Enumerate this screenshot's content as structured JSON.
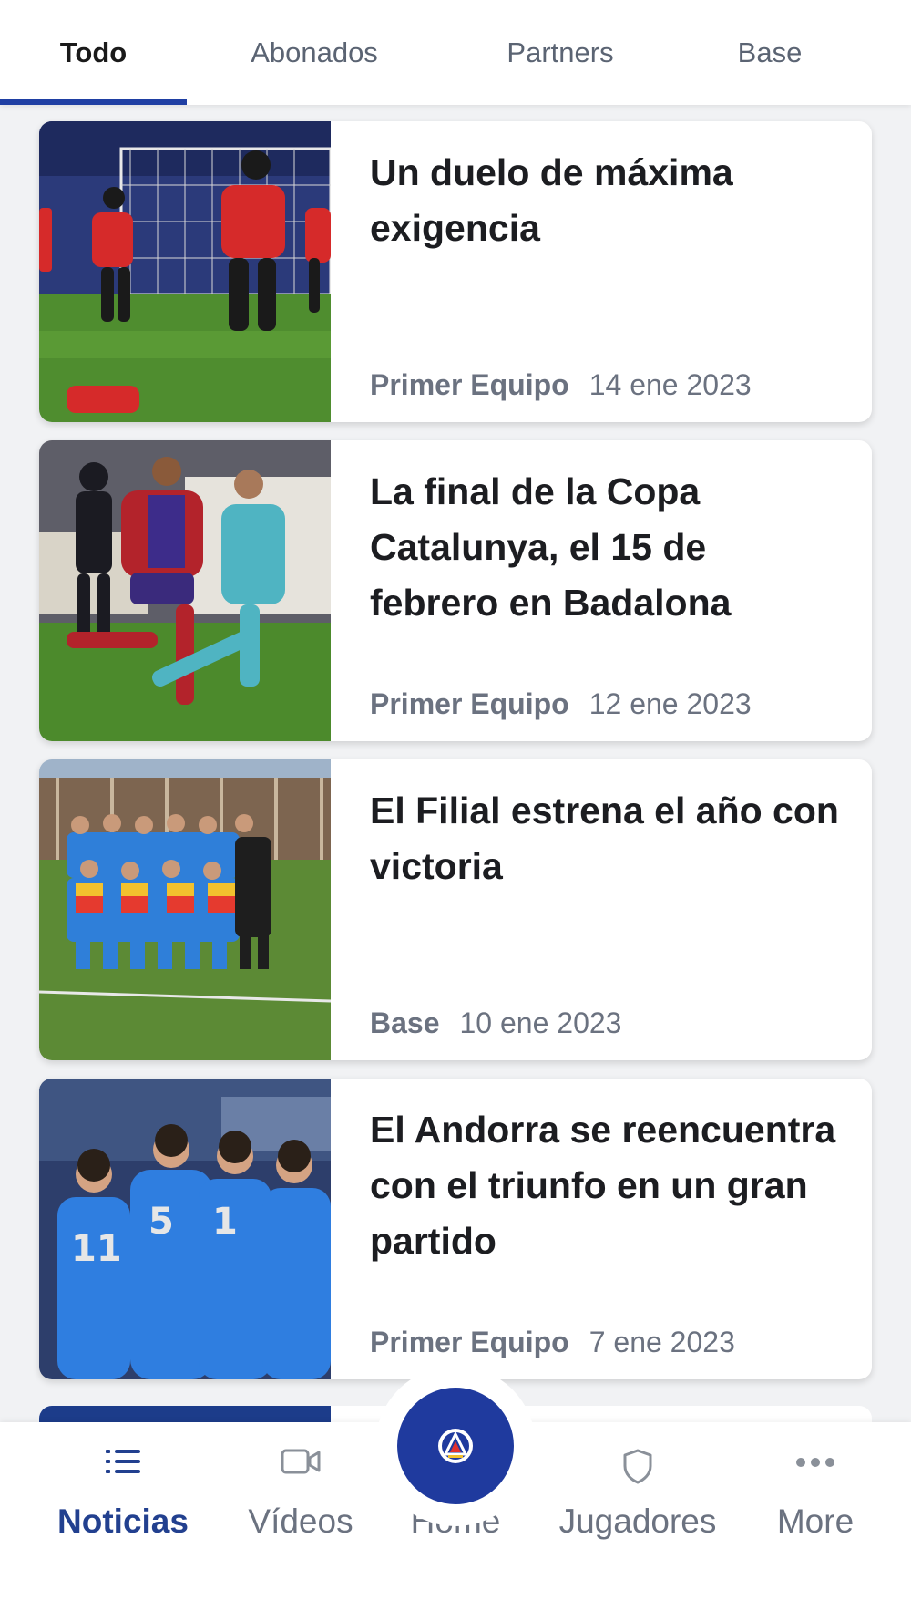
{
  "tabs": [
    {
      "label": "Todo",
      "active": true
    },
    {
      "label": "Abonados",
      "active": false
    },
    {
      "label": "Partners",
      "active": false
    },
    {
      "label": "Base",
      "active": false
    }
  ],
  "articles": [
    {
      "title": "Un duelo de máxima exigencia",
      "category": "Primer Equipo",
      "date": "14 ene 2023"
    },
    {
      "title": "La final de la Copa Catalunya, el 15 de febrero en Badalona",
      "category": "Primer Equipo",
      "date": "12 ene 2023"
    },
    {
      "title": "El Filial estrena el año con victoria",
      "category": "Base",
      "date": "10 ene 2023"
    },
    {
      "title": "El Andorra se reencuentra con el triunfo en un gran partido",
      "category": "Primer Equipo",
      "date": "7 ene 2023"
    }
  ],
  "bottom_nav": {
    "items": [
      {
        "label": "Noticias",
        "icon": "list-icon",
        "active": true
      },
      {
        "label": "Vídeos",
        "icon": "video-camera-icon",
        "active": false
      },
      {
        "label": "Home",
        "icon": "club-crest-icon",
        "active": false
      },
      {
        "label": "Jugadores",
        "icon": "shield-icon",
        "active": false
      },
      {
        "label": "More",
        "icon": "more-dots-icon",
        "active": false
      }
    ]
  },
  "colors": {
    "accent": "#1f3fa3",
    "active_nav": "#22408f",
    "background": "#f1f2f4"
  }
}
